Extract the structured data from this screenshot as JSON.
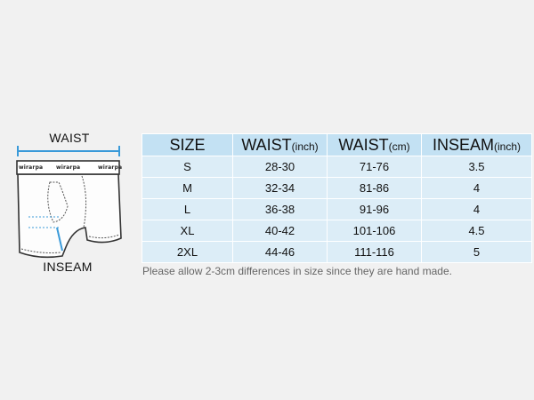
{
  "illustration": {
    "waist_label": "WAIST",
    "inseam_label": "INSEAM",
    "brand": "wirarpa"
  },
  "table": {
    "headers": [
      {
        "main": "SIZE",
        "unit": ""
      },
      {
        "main": "WAIST",
        "unit": "(inch)"
      },
      {
        "main": "WAIST",
        "unit": "(cm)"
      },
      {
        "main": "INSEAM",
        "unit": "(inch)"
      }
    ],
    "rows": [
      [
        "S",
        "28-30",
        "71-76",
        "3.5"
      ],
      [
        "M",
        "32-34",
        "81-86",
        "4"
      ],
      [
        "L",
        "36-38",
        "91-96",
        "4"
      ],
      [
        "XL",
        "40-42",
        "101-106",
        "4.5"
      ],
      [
        "2XL",
        "44-46",
        "111-116",
        "5"
      ]
    ]
  },
  "note": "Please allow 2-3cm differences in size since they are hand made.",
  "colors": {
    "background": "#f1f1f1",
    "header_fill": "#c3e1f3",
    "cell_fill": "#dcedf7",
    "measure_line": "#3a9ad9"
  }
}
